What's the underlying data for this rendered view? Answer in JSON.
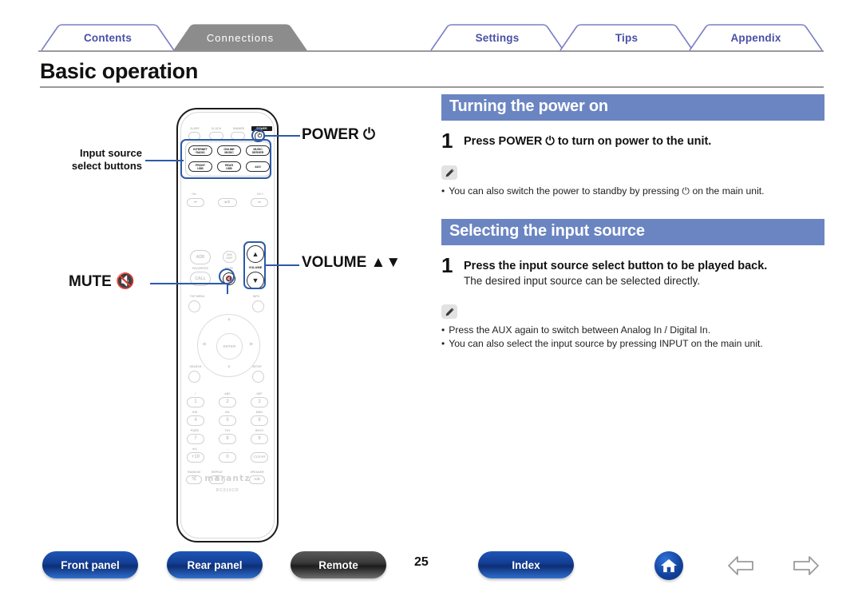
{
  "tabs": [
    {
      "label": "Contents",
      "active": false
    },
    {
      "label": "Connections",
      "active": true
    },
    {
      "label": "Settings",
      "active": false
    },
    {
      "label": "Tips",
      "active": false
    },
    {
      "label": "Appendix",
      "active": false
    }
  ],
  "page_title": "Basic operation",
  "sections": [
    {
      "heading": "Turning the power on",
      "steps": [
        {
          "num": "1",
          "main": "Press POWER ⏻ to turn on power to the unit.",
          "sub": ""
        }
      ],
      "notes": [
        "You can also switch the power to standby by pressing ⏻ on the main unit."
      ]
    },
    {
      "heading": "Selecting the input source",
      "steps": [
        {
          "num": "1",
          "main": "Press the input source select button to be played back.",
          "sub": "The desired input source can be selected directly."
        }
      ],
      "notes": [
        "Press the AUX again to switch between Analog In / Digital In.",
        "You can also select the input source by pressing INPUT on the main unit."
      ]
    }
  ],
  "callouts": {
    "power": "POWER ⏻",
    "input_source": "Input source\nselect buttons",
    "input_source_line1": "Input source",
    "input_source_line2": "select buttons",
    "volume": "VOLUME ▲▼",
    "mute": "MUTE ⬜"
  },
  "remote": {
    "brand": "marantz",
    "model": "RC010CR",
    "top_row": [
      "SLEEP",
      "CLOCK",
      "DIMMER",
      "POWER"
    ],
    "source_buttons": [
      {
        "l1": "INTERNET",
        "l2": "RADIO"
      },
      {
        "l1": "ONLINE",
        "l2": "MUSIC"
      },
      {
        "l1": "MUSIC",
        "l2": "SERVER"
      },
      {
        "l1": "FRONT",
        "l2": "USB"
      },
      {
        "l1": "REAR",
        "l2": "USB"
      },
      {
        "l1": "AUX",
        "l2": ""
      }
    ],
    "transport_labels": [
      "CH -",
      "",
      "CH +"
    ],
    "transport_glyphs": [
      "⏮",
      "▶/Ⅱ",
      "⏭"
    ],
    "fav_labels": [
      "ADD",
      "FAVORITES",
      "CALL",
      "DIM/DISP",
      "MUTE"
    ],
    "volume_label": "VOLUME",
    "nav_labels": [
      "TOP MENU",
      "INFO",
      "ENTER",
      "SEARCH",
      "SETUP"
    ],
    "keypad": [
      {
        "top": ".  /",
        "key": "1"
      },
      {
        "top": "ABC",
        "key": "2"
      },
      {
        "top": "DEF",
        "key": "3"
      },
      {
        "top": "GHI",
        "key": "4"
      },
      {
        "top": "JKL",
        "key": "5"
      },
      {
        "top": "MNO",
        "key": "6"
      },
      {
        "top": "PQRS",
        "key": "7"
      },
      {
        "top": "TUV",
        "key": "8"
      },
      {
        "top": "WXYZ",
        "key": "9"
      },
      {
        "top": "a/A",
        "key": "+10"
      },
      {
        "top": "-  ,",
        "key": "0"
      },
      {
        "top": "",
        "key": "CLEAR"
      }
    ],
    "bottom_labels": [
      "RANDOM",
      "REPEAT",
      "SPEAKER"
    ],
    "bottom_glyphs": [
      "⤭",
      "⟲",
      "A/B"
    ]
  },
  "footer": {
    "buttons": [
      {
        "label": "Front panel",
        "style": "blue"
      },
      {
        "label": "Rear panel",
        "style": "blue"
      },
      {
        "label": "Remote",
        "style": "dark"
      },
      {
        "label": "Index",
        "style": "blue"
      }
    ],
    "page_number": "25",
    "home_label": "home-icon",
    "prev_label": "previous-page",
    "next_label": "next-page"
  },
  "colors": {
    "accent_heading": "#6b85c2",
    "tab_text": "#4a4fa8",
    "tab_active_bg": "#8c8c8c",
    "lead_line": "#2c5aa8",
    "footer_blue": "#143f96"
  }
}
